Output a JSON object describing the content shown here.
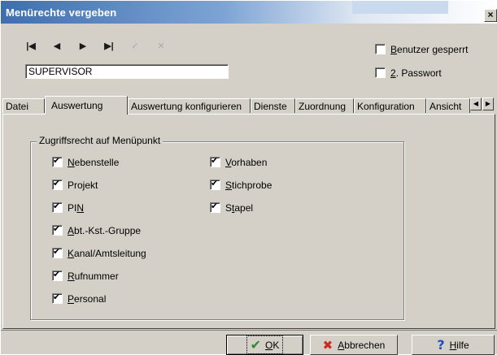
{
  "window": {
    "title": "Menürechte vergeben",
    "close_symbol": "×"
  },
  "toolbar": {
    "first_icon": "⏮",
    "prev_icon": "◀",
    "next_icon": "▶",
    "last_icon": "⏭",
    "confirm_icon": "✓",
    "cancel_icon": "✕"
  },
  "user": {
    "name_value": "SUPERVISOR"
  },
  "options": {
    "locked_label_accel": "B",
    "locked_label_rest": "enutzer gesperrt",
    "locked_checked": false,
    "second_pw_label_pre": "",
    "second_pw_label_accel": "2",
    "second_pw_label_rest": ". Passwort",
    "second_pw_checked": false
  },
  "tabs": [
    {
      "label": "Datei"
    },
    {
      "label": "Auswertung"
    },
    {
      "label": "Auswertung konfigurieren"
    },
    {
      "label": "Dienste"
    },
    {
      "label": "Zuordnung"
    },
    {
      "label": "Konfiguration"
    },
    {
      "label": "Ansicht"
    }
  ],
  "tab_scroll": {
    "left": "◀",
    "right": "▶"
  },
  "group": {
    "title": "Zugriffsrecht auf Menüpunkt",
    "col1": [
      {
        "pre": "",
        "accel": "N",
        "rest": "ebenstelle",
        "checked": true
      },
      {
        "pre": "Projekt",
        "accel": "",
        "rest": "",
        "checked": true
      },
      {
        "pre": "PI",
        "accel": "N",
        "rest": "",
        "checked": true
      },
      {
        "pre": "",
        "accel": "A",
        "rest": "bt.-Kst.-Gruppe",
        "checked": true
      },
      {
        "pre": "",
        "accel": "K",
        "rest": "anal/Amtsleitung",
        "checked": true
      },
      {
        "pre": "",
        "accel": "R",
        "rest": "ufnummer",
        "checked": true
      },
      {
        "pre": "",
        "accel": "P",
        "rest": "ersonal",
        "checked": true
      }
    ],
    "col2": [
      {
        "pre": "",
        "accel": "V",
        "rest": "orhaben",
        "checked": true
      },
      {
        "pre": "",
        "accel": "S",
        "rest": "tichprobe",
        "checked": true
      },
      {
        "pre": "S",
        "accel": "t",
        "rest": "apel",
        "checked": true
      }
    ]
  },
  "buttons": {
    "ok": {
      "accel": "O",
      "rest": "K"
    },
    "cancel": {
      "accel": "A",
      "rest": "bbrechen"
    },
    "help": {
      "accel": "H",
      "rest": "ilfe"
    }
  },
  "colors": {
    "title_start": "#3d6fb0",
    "face": "#d4d0c8",
    "ok": "#2e8b2e",
    "cancel": "#cc2b1d",
    "help": "#1f4fbf"
  }
}
